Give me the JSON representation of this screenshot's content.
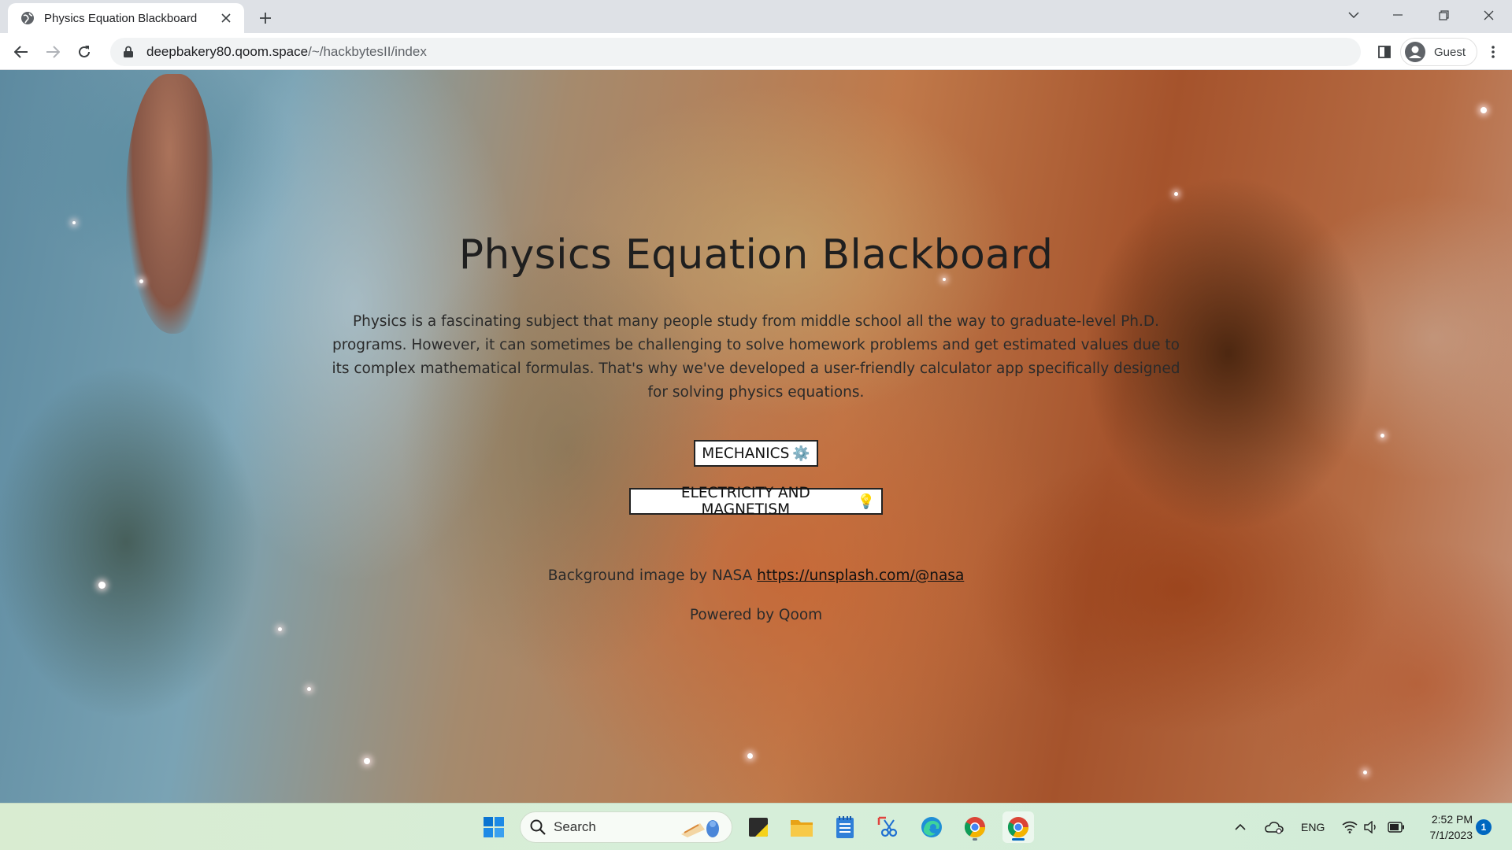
{
  "browser": {
    "tab_title": "Physics Equation Blackboard",
    "url_host": "deepbakery80.qoom.space",
    "url_path": "/~/hackbytesII/index",
    "profile_label": "Guest"
  },
  "page": {
    "title": "Physics Equation Blackboard",
    "intro": "Physics is a fascinating subject that many people study from middle school all the way to graduate-level Ph.D. programs. However, it can sometimes be challenging to solve homework problems and get estimated values due to its complex mathematical formulas. That's why we've developed a user-friendly calculator app specifically designed for solving physics equations.",
    "buttons": {
      "mechanics_label": "MECHANICS",
      "mechanics_emoji": "⚙️",
      "em_label": "ELECTRICITY AND MAGNETISM",
      "em_emoji": "💡"
    },
    "credit_text": "Background image by NASA ",
    "credit_link": "https://unsplash.com/@nasa",
    "powered_by": "Powered by Qoom"
  },
  "taskbar": {
    "search_placeholder": "Search",
    "language": "ENG",
    "time": "2:52 PM",
    "date": "7/1/2023",
    "notification_count": "1"
  },
  "colors": {
    "tabbar_bg": "#dee1e6",
    "omnibox_bg": "#f1f3f4",
    "taskbar_accent": "#0067c0"
  }
}
